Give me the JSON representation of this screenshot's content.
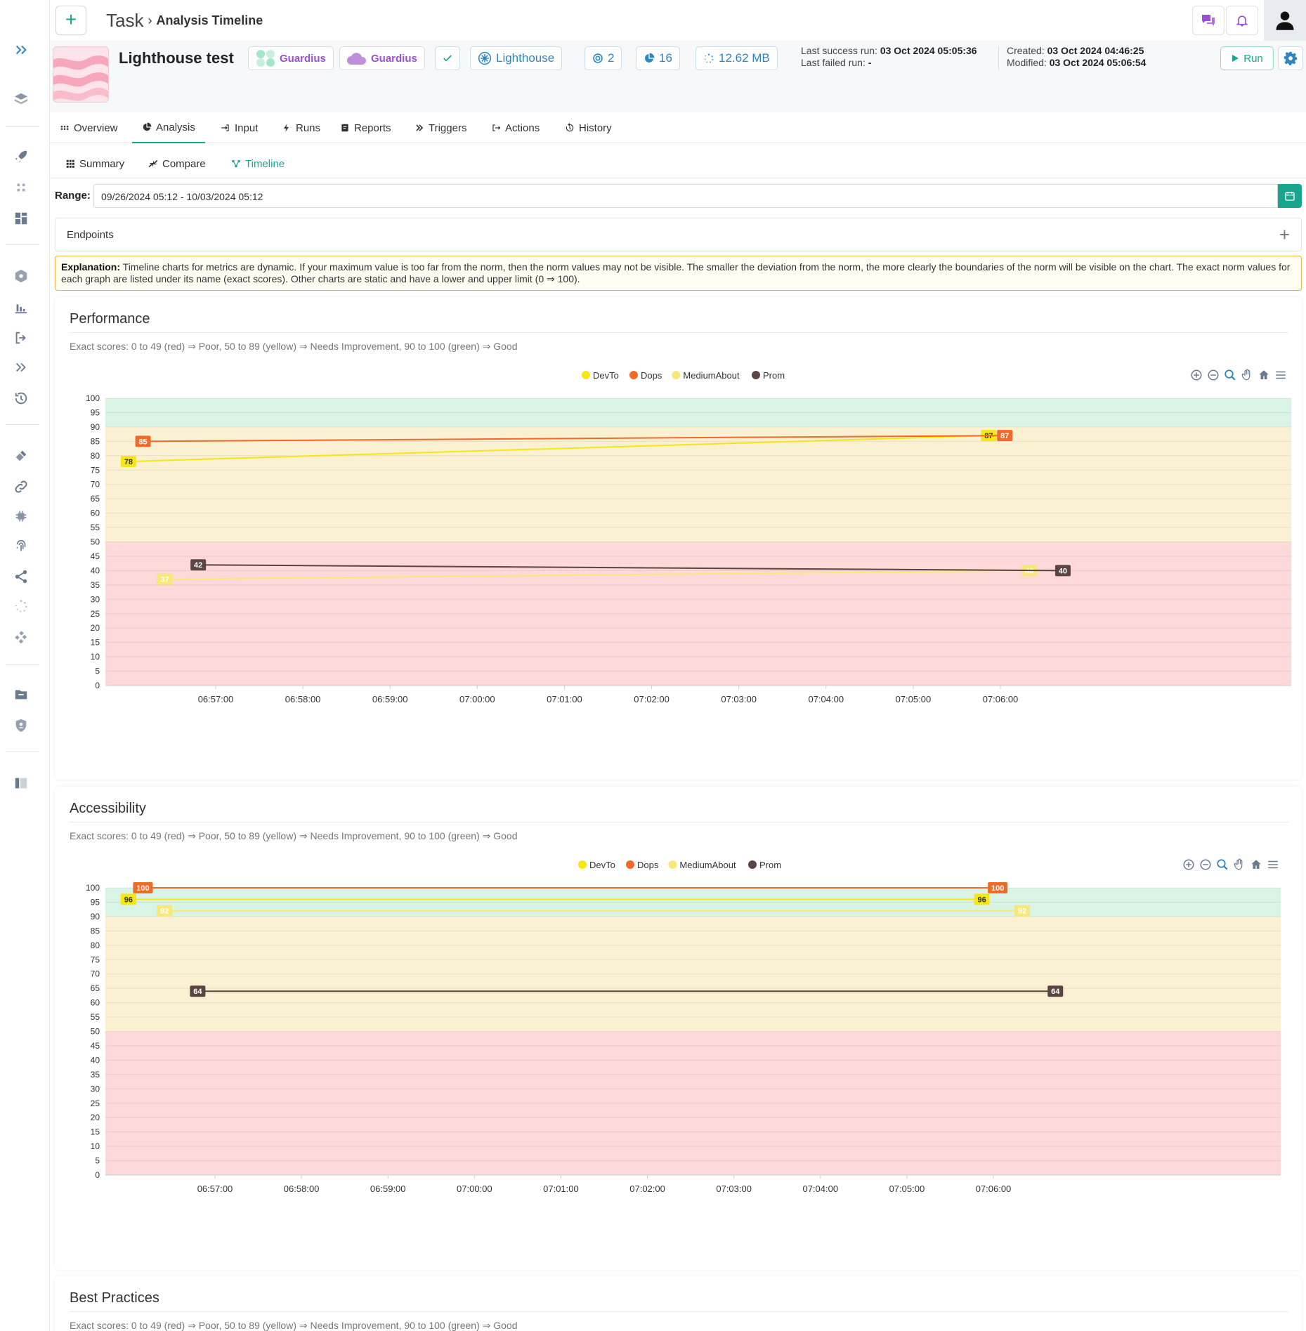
{
  "topbar": {
    "add_label": "+",
    "breadcrumb_root": "Task",
    "breadcrumb_current": "Analysis Timeline"
  },
  "header": {
    "title": "Lighthouse test",
    "chip_project": "Guardius",
    "chip_cloud": "Guardius",
    "chip_type": "Lighthouse",
    "chip_count_a": "2",
    "chip_count_b": "16",
    "chip_size": "12.62 MB",
    "last_success_label": "Last success run:",
    "last_success_value": "03 Oct 2024 05:05:36",
    "last_failed_label": "Last failed run:",
    "last_failed_value": "-",
    "created_label": "Created:",
    "created_value": "03 Oct 2024 04:46:25",
    "modified_label": "Modified:",
    "modified_value": "03 Oct 2024 05:06:54",
    "run_label": "Run"
  },
  "tabs": [
    {
      "label": "Overview",
      "icon": "grid-dots-icon"
    },
    {
      "label": "Analysis",
      "icon": "pie-chart-icon",
      "active": true
    },
    {
      "label": "Input",
      "icon": "sign-in-icon"
    },
    {
      "label": "Runs",
      "icon": "bolt-icon"
    },
    {
      "label": "Reports",
      "icon": "report-icon"
    },
    {
      "label": "Triggers",
      "icon": "double-chevron-icon"
    },
    {
      "label": "Actions",
      "icon": "sign-out-icon"
    },
    {
      "label": "History",
      "icon": "history-icon"
    }
  ],
  "subtabs": [
    {
      "label": "Summary",
      "icon": "grid-icon"
    },
    {
      "label": "Compare",
      "icon": "compress-icon"
    },
    {
      "label": "Timeline",
      "icon": "timeline-icon",
      "active": true
    }
  ],
  "range": {
    "label": "Range:",
    "value": "09/26/2024 05:12 - 10/03/2024 05:12"
  },
  "endpoints": {
    "label": "Endpoints",
    "expand": "+"
  },
  "explanation": {
    "label": "Explanation:",
    "text": "Timeline charts for metrics are dynamic. If your maximum value is too far from the norm, then the norm values may not be visible. The smaller the deviation from the norm, the more clearly the boundaries of the norm will be visible on the chart. The exact norm values for each graph are listed under its name (exact scores). Other charts are static and have a lower and upper limit (0 ⇒ 100)."
  },
  "colors": {
    "devto": "#f5e614",
    "dops": "#f06a2a",
    "mediumabout": "#f7e87a",
    "prom": "#5a4540",
    "green_zone": "#d9f3e4",
    "yellow_zone": "#faf0d2",
    "red_zone": "#fdd9d9",
    "accent": "#1aa58f"
  },
  "charts": [
    {
      "title": "Performance",
      "subtitle": "Exact scores: 0 to 49 (red) ⇒ Poor, 50 to 89 (yellow) ⇒ Needs Improvement, 90 to 100 (green) ⇒ Good"
    },
    {
      "title": "Accessibility",
      "subtitle": "Exact scores: 0 to 49 (red) ⇒ Poor, 50 to 89 (yellow) ⇒ Needs Improvement, 90 to 100 (green) ⇒ Good"
    },
    {
      "title": "Best Practices",
      "subtitle": "Exact scores: 0 to 49 (red) ⇒ Poor, 50 to 89 (yellow) ⇒ Needs Improvement, 90 to 100 (green) ⇒ Good"
    }
  ],
  "chart_data": [
    {
      "type": "line",
      "title": "Performance",
      "ylim": [
        0,
        100
      ],
      "yticks": [
        0,
        5,
        10,
        15,
        20,
        25,
        30,
        35,
        40,
        45,
        50,
        55,
        60,
        65,
        70,
        75,
        80,
        85,
        90,
        95,
        100
      ],
      "x_ticks": [
        "06:57:00",
        "06:58:00",
        "06:59:00",
        "07:00:00",
        "07:01:00",
        "07:02:00",
        "07:03:00",
        "07:04:00",
        "07:05:00",
        "07:06:00"
      ],
      "zones": [
        {
          "from": 0,
          "to": 50,
          "color": "red"
        },
        {
          "from": 50,
          "to": 90,
          "color": "yellow"
        },
        {
          "from": 90,
          "to": 100,
          "color": "green"
        }
      ],
      "legend": [
        "DevTo",
        "Dops",
        "MediumAbout",
        "Prom"
      ],
      "series": [
        {
          "name": "DevTo",
          "points": [
            [
              "06:56:00",
              78
            ],
            [
              "07:05:52",
              87
            ]
          ]
        },
        {
          "name": "Dops",
          "points": [
            [
              "06:56:10",
              85
            ],
            [
              "07:06:03",
              87
            ]
          ]
        },
        {
          "name": "MediumAbout",
          "points": [
            [
              "06:56:25",
              37
            ],
            [
              "07:06:20",
              40
            ]
          ]
        },
        {
          "name": "Prom",
          "points": [
            [
              "06:56:48",
              42
            ],
            [
              "07:06:43",
              40
            ]
          ]
        }
      ]
    },
    {
      "type": "line",
      "title": "Accessibility",
      "ylim": [
        0,
        100
      ],
      "yticks": [
        0,
        5,
        10,
        15,
        20,
        25,
        30,
        35,
        40,
        45,
        50,
        55,
        60,
        65,
        70,
        75,
        80,
        85,
        90,
        95,
        100
      ],
      "x_ticks": [
        "06:57:00",
        "06:58:00",
        "06:59:00",
        "07:00:00",
        "07:01:00",
        "07:02:00",
        "07:03:00",
        "07:04:00",
        "07:05:00",
        "07:06:00"
      ],
      "zones": [
        {
          "from": 0,
          "to": 50,
          "color": "red"
        },
        {
          "from": 50,
          "to": 90,
          "color": "yellow"
        },
        {
          "from": 90,
          "to": 100,
          "color": "green"
        }
      ],
      "legend": [
        "DevTo",
        "Dops",
        "MediumAbout",
        "Prom"
      ],
      "series": [
        {
          "name": "DevTo",
          "points": [
            [
              "06:56:00",
              96
            ],
            [
              "07:05:52",
              96
            ]
          ]
        },
        {
          "name": "Dops",
          "points": [
            [
              "06:56:10",
              100
            ],
            [
              "07:06:03",
              100
            ]
          ]
        },
        {
          "name": "MediumAbout",
          "points": [
            [
              "06:56:25",
              92
            ],
            [
              "07:06:20",
              92
            ]
          ]
        },
        {
          "name": "Prom",
          "points": [
            [
              "06:56:48",
              64
            ],
            [
              "07:06:43",
              64
            ]
          ]
        }
      ]
    }
  ]
}
